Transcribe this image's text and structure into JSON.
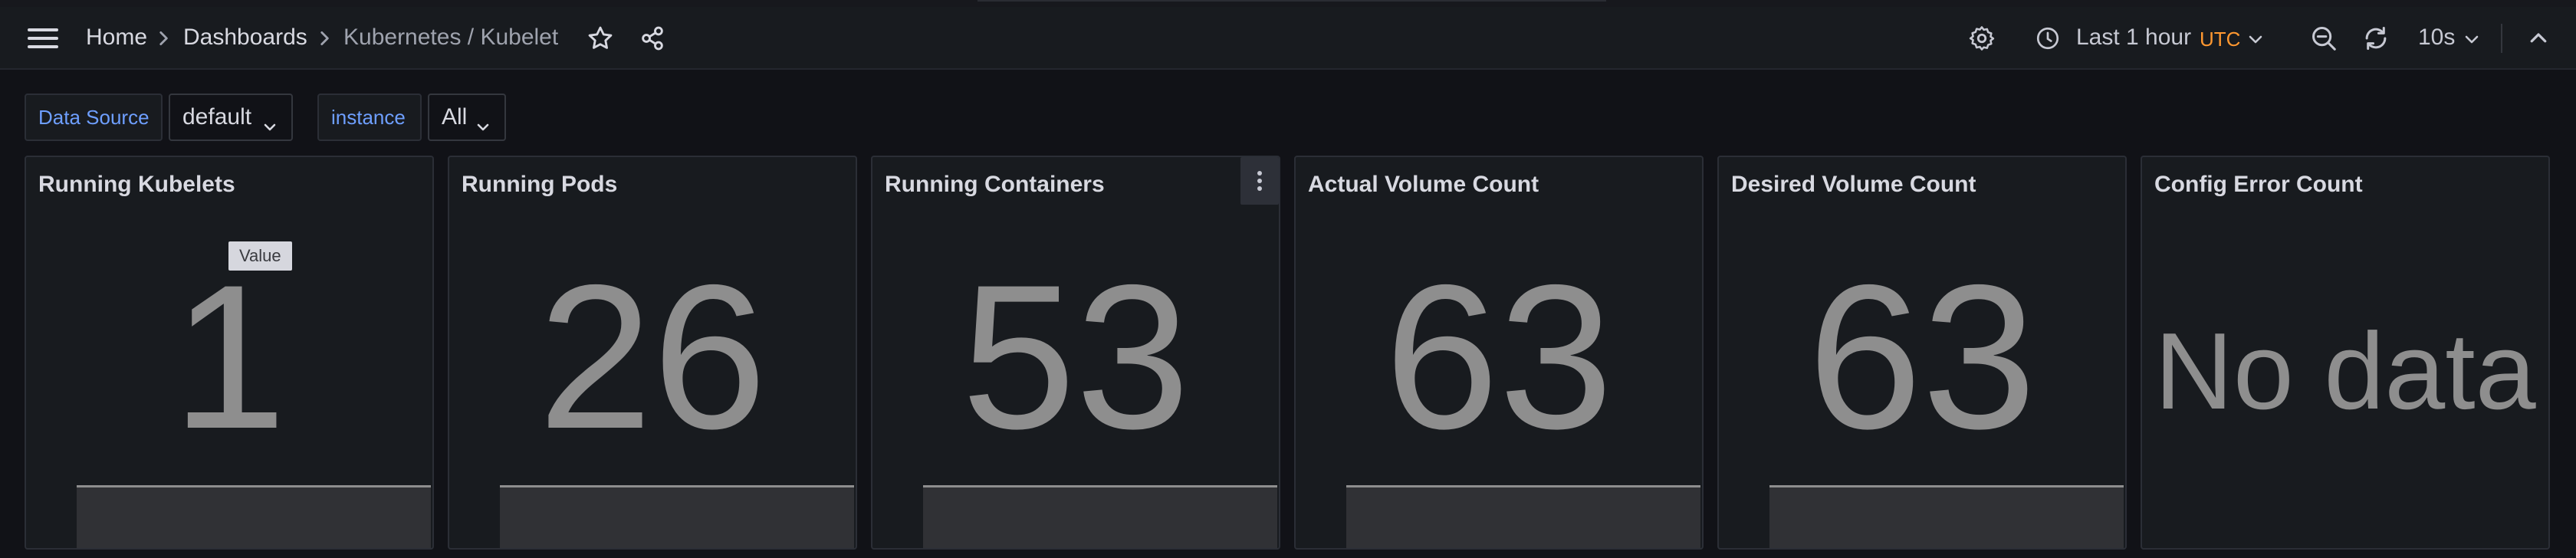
{
  "breadcrumbs": [
    "Home",
    "Dashboards",
    "Kubernetes / Kubelet"
  ],
  "nav": {
    "time_range": "Last 1 hour",
    "timezone": "UTC",
    "refresh_interval": "10s"
  },
  "variables": [
    {
      "label": "Data Source",
      "value": "default"
    },
    {
      "label": "instance",
      "value": "All"
    }
  ],
  "panels": [
    {
      "title": "Running Kubelets",
      "value": "1"
    },
    {
      "title": "Running Pods",
      "value": "26"
    },
    {
      "title": "Running Containers",
      "value": "53"
    },
    {
      "title": "Actual Volume Count",
      "value": "63"
    },
    {
      "title": "Desired Volume Count",
      "value": "63"
    },
    {
      "title": "Config Error Count",
      "value": "No data"
    }
  ],
  "tooltip": "Value",
  "colors": {
    "background": "#111217",
    "panel": "#181b1f",
    "accent_label": "#6e9fff",
    "timezone": "#ff9830",
    "stat_value": "#8e8e8e"
  },
  "icons": [
    "menu-icon",
    "chevron-right-icon",
    "star-icon",
    "share-icon",
    "gear-icon",
    "clock-icon",
    "chevron-down-icon",
    "zoom-out-icon",
    "refresh-icon",
    "chevron-up-icon",
    "more-vertical-icon"
  ]
}
